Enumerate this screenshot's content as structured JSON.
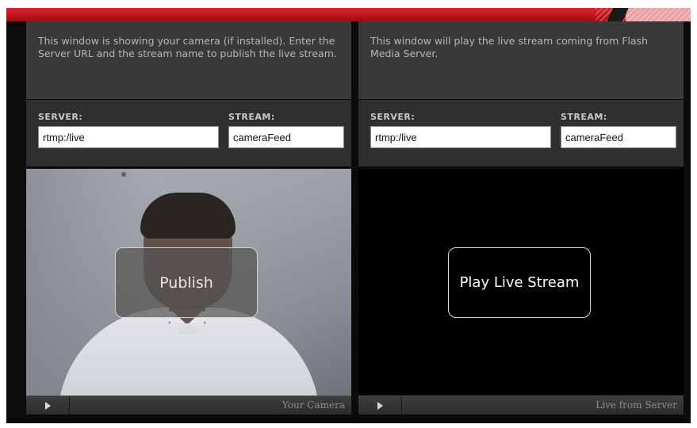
{
  "colors": {
    "brand_red": "#c4141c",
    "panel_bg": "#393939",
    "field_bg": "#2f2f2f"
  },
  "publisher": {
    "description": "This window is showing your camera (if installed). Enter the Server URL and the stream name to publish the live stream.",
    "server_label": "SERVER:",
    "server_value": "rtmp:/live",
    "stream_label": "STREAM:",
    "stream_value": "cameraFeed",
    "action_label": "Publish",
    "play_icon": "play-icon",
    "footer_label": "Your Camera"
  },
  "player": {
    "description": "This window will play the live stream coming from Flash Media Server.",
    "server_label": "SERVER:",
    "server_value": "rtmp:/live",
    "stream_label": "STREAM:",
    "stream_value": "cameraFeed",
    "action_label": "Play Live Stream",
    "play_icon": "play-icon",
    "footer_label": "Live from Server"
  }
}
